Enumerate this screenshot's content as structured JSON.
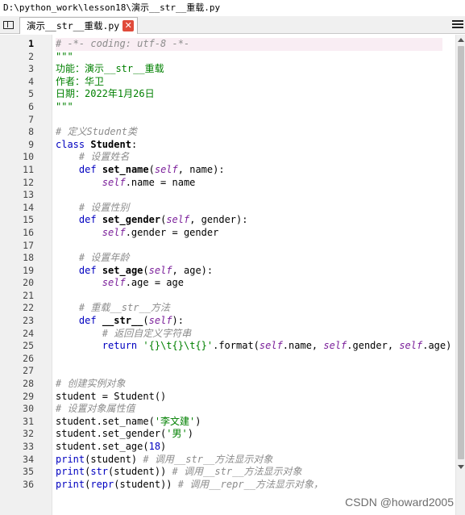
{
  "window": {
    "path": "D:\\python_work\\lesson18\\演示__str__重载.py"
  },
  "tab": {
    "label": "演示__str__重载.py",
    "close_glyph": "✕"
  },
  "watermark": "CSDN @howard2005",
  "colors": {
    "comment": "#8c8c8c",
    "string": "#008000",
    "keyword": "#0000c0",
    "self": "#7b1f9a",
    "current_line": "#f9edf3"
  },
  "editor": {
    "current_line": 1,
    "lines": [
      {
        "n": "1",
        "tokens": [
          [
            "# -*- coding: utf-8 -*-",
            "comment"
          ]
        ]
      },
      {
        "n": "2",
        "tokens": [
          [
            "\"\"\"",
            "string"
          ]
        ]
      },
      {
        "n": "3",
        "tokens": [
          [
            "功能：演示__str__重载",
            "string"
          ]
        ]
      },
      {
        "n": "4",
        "tokens": [
          [
            "作者：华卫",
            "string"
          ]
        ]
      },
      {
        "n": "5",
        "tokens": [
          [
            "日期：2022年1月26日",
            "string"
          ]
        ]
      },
      {
        "n": "6",
        "tokens": [
          [
            "\"\"\"",
            "string"
          ]
        ]
      },
      {
        "n": "7",
        "tokens": []
      },
      {
        "n": "8",
        "tokens": [
          [
            "# 定义Student类",
            "comment"
          ]
        ]
      },
      {
        "n": "9",
        "tokens": [
          [
            "class",
            "keyword"
          ],
          [
            " ",
            "text"
          ],
          [
            "Student",
            "bold"
          ],
          [
            ":",
            "text"
          ]
        ]
      },
      {
        "n": "10",
        "tokens": [
          [
            "    ",
            "text"
          ],
          [
            "# 设置姓名",
            "comment"
          ]
        ]
      },
      {
        "n": "11",
        "tokens": [
          [
            "    ",
            "text"
          ],
          [
            "def",
            "keyword"
          ],
          [
            " ",
            "text"
          ],
          [
            "set_name",
            "bold"
          ],
          [
            "(",
            "text"
          ],
          [
            "self",
            "self"
          ],
          [
            ", name):",
            "text"
          ]
        ]
      },
      {
        "n": "12",
        "tokens": [
          [
            "        ",
            "text"
          ],
          [
            "self",
            "self"
          ],
          [
            ".name = name",
            "text"
          ]
        ]
      },
      {
        "n": "13",
        "tokens": []
      },
      {
        "n": "14",
        "tokens": [
          [
            "    ",
            "text"
          ],
          [
            "# 设置性别",
            "comment"
          ]
        ]
      },
      {
        "n": "15",
        "tokens": [
          [
            "    ",
            "text"
          ],
          [
            "def",
            "keyword"
          ],
          [
            " ",
            "text"
          ],
          [
            "set_gender",
            "bold"
          ],
          [
            "(",
            "text"
          ],
          [
            "self",
            "self"
          ],
          [
            ", gender):",
            "text"
          ]
        ]
      },
      {
        "n": "16",
        "tokens": [
          [
            "        ",
            "text"
          ],
          [
            "self",
            "self"
          ],
          [
            ".gender = gender",
            "text"
          ]
        ]
      },
      {
        "n": "17",
        "tokens": []
      },
      {
        "n": "18",
        "tokens": [
          [
            "    ",
            "text"
          ],
          [
            "# 设置年龄",
            "comment"
          ]
        ]
      },
      {
        "n": "19",
        "tokens": [
          [
            "    ",
            "text"
          ],
          [
            "def",
            "keyword"
          ],
          [
            " ",
            "text"
          ],
          [
            "set_age",
            "bold"
          ],
          [
            "(",
            "text"
          ],
          [
            "self",
            "self"
          ],
          [
            ", age):",
            "text"
          ]
        ]
      },
      {
        "n": "20",
        "tokens": [
          [
            "        ",
            "text"
          ],
          [
            "self",
            "self"
          ],
          [
            ".age = age",
            "text"
          ]
        ]
      },
      {
        "n": "21",
        "tokens": []
      },
      {
        "n": "22",
        "tokens": [
          [
            "    ",
            "text"
          ],
          [
            "# 重载__str__方法",
            "comment"
          ]
        ]
      },
      {
        "n": "23",
        "tokens": [
          [
            "    ",
            "text"
          ],
          [
            "def",
            "keyword"
          ],
          [
            " ",
            "text"
          ],
          [
            "__str__",
            "bold"
          ],
          [
            "(",
            "text"
          ],
          [
            "self",
            "self"
          ],
          [
            "):",
            "text"
          ]
        ]
      },
      {
        "n": "24",
        "tokens": [
          [
            "        ",
            "text"
          ],
          [
            "# 返回自定义字符串",
            "comment"
          ]
        ]
      },
      {
        "n": "25",
        "tokens": [
          [
            "        ",
            "text"
          ],
          [
            "return",
            "keyword"
          ],
          [
            " ",
            "text"
          ],
          [
            "'{}\\t{}\\t{}'",
            "string"
          ],
          [
            ".format(",
            "text"
          ],
          [
            "self",
            "self"
          ],
          [
            ".name, ",
            "text"
          ],
          [
            "self",
            "self"
          ],
          [
            ".gender, ",
            "text"
          ],
          [
            "self",
            "self"
          ],
          [
            ".age)",
            "text"
          ]
        ]
      },
      {
        "n": "26",
        "tokens": []
      },
      {
        "n": "27",
        "tokens": []
      },
      {
        "n": "28",
        "tokens": [
          [
            "# 创建实例对象",
            "comment"
          ]
        ]
      },
      {
        "n": "29",
        "tokens": [
          [
            "student = Student()",
            "text"
          ]
        ]
      },
      {
        "n": "30",
        "tokens": [
          [
            "# 设置对象属性值",
            "comment"
          ]
        ]
      },
      {
        "n": "31",
        "tokens": [
          [
            "student.set_name(",
            "text"
          ],
          [
            "'李文建'",
            "string"
          ],
          [
            ")",
            "text"
          ]
        ]
      },
      {
        "n": "32",
        "tokens": [
          [
            "student.set_gender(",
            "text"
          ],
          [
            "'男'",
            "string"
          ],
          [
            ")",
            "text"
          ]
        ]
      },
      {
        "n": "33",
        "tokens": [
          [
            "student.set_age(",
            "text"
          ],
          [
            "18",
            "number"
          ],
          [
            ")",
            "text"
          ]
        ]
      },
      {
        "n": "34",
        "tokens": [
          [
            "print",
            "keyword"
          ],
          [
            "(student) ",
            "text"
          ],
          [
            "# 调用__str__方法显示对象",
            "comment"
          ]
        ]
      },
      {
        "n": "35",
        "tokens": [
          [
            "print",
            "keyword"
          ],
          [
            "(",
            "text"
          ],
          [
            "str",
            "keyword"
          ],
          [
            "(student)) ",
            "text"
          ],
          [
            "# 调用__str__方法显示对象",
            "comment"
          ]
        ]
      },
      {
        "n": "36",
        "tokens": [
          [
            "print",
            "keyword"
          ],
          [
            "(",
            "text"
          ],
          [
            "repr",
            "keyword"
          ],
          [
            "(student)) ",
            "text"
          ],
          [
            "# 调用__repr__方法显示对象，",
            "comment"
          ]
        ]
      }
    ]
  }
}
